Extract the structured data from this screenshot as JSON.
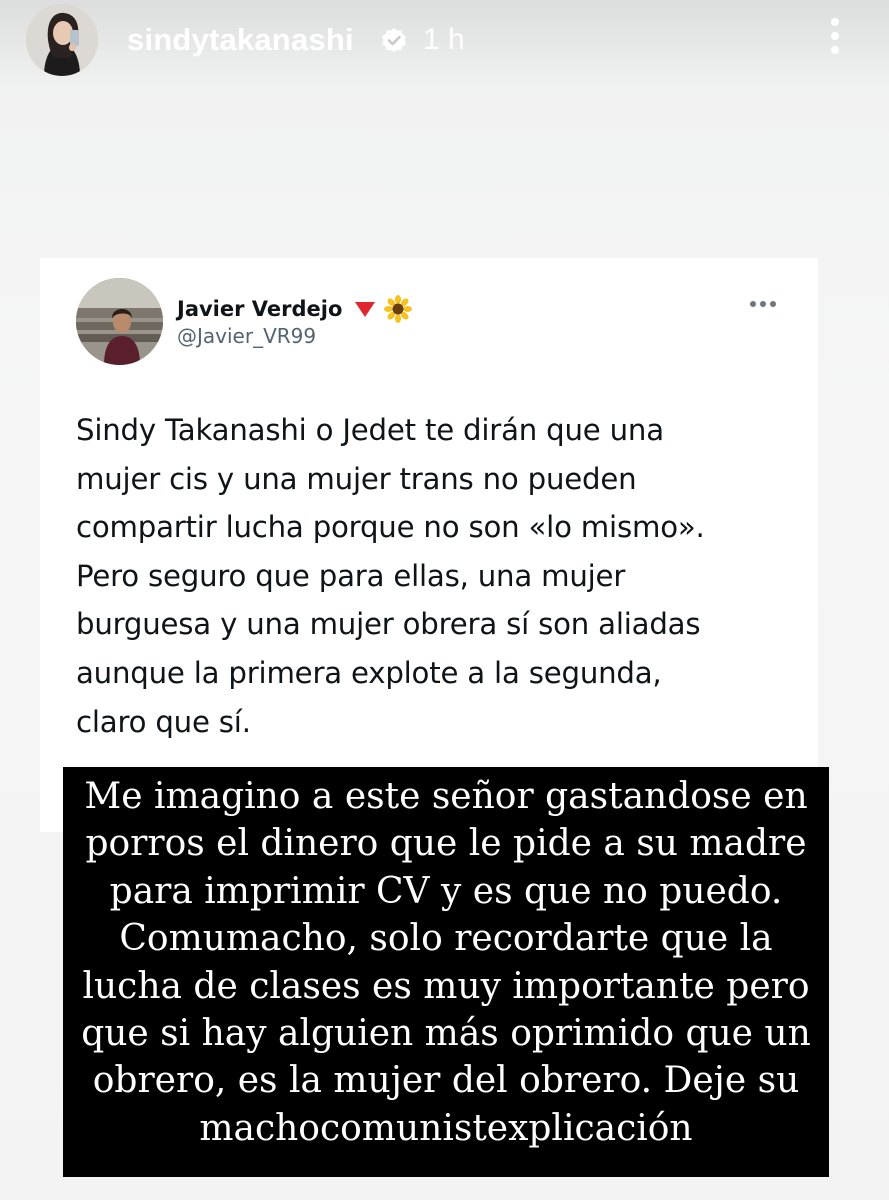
{
  "story": {
    "username": "sindytakanashi",
    "time": "1 h",
    "verified": true
  },
  "tweet": {
    "author_name": "Javier Verdejo",
    "handle": "@Javier_VR99",
    "name_emojis": [
      "red-triangle-icon",
      "sunflower-icon"
    ],
    "text_lines": [
      "Sindy Takanashi o Jedet te dirán que una",
      "mujer cis y una mujer trans no pueden",
      "compartir lucha porque no son «lo mismo».",
      "Pero seguro que para ellas, una mujer",
      "burguesa y una mujer obrera sí son aliadas",
      "aunque la primera explote a la segunda,",
      "claro que sí."
    ]
  },
  "caption": {
    "lines": [
      "Me imagino a este señor gastandose en",
      "porros el dinero que le pide a su madre",
      "para imprimir CV y es que no puedo.",
      "Comumacho, solo recordarte que la",
      "lucha de clases es muy importante pero",
      "que si hay alguien más oprimido que un",
      "obrero, es la mujer del obrero. Deje su",
      "machocomunistexplicación"
    ]
  },
  "colors": {
    "story_background": "#f3f3f3",
    "tweet_text": "#0f1419",
    "handle_gray": "#536471",
    "caption_background": "#000000",
    "caption_text": "#ffffff",
    "verified_blue": "#ffffff"
  }
}
